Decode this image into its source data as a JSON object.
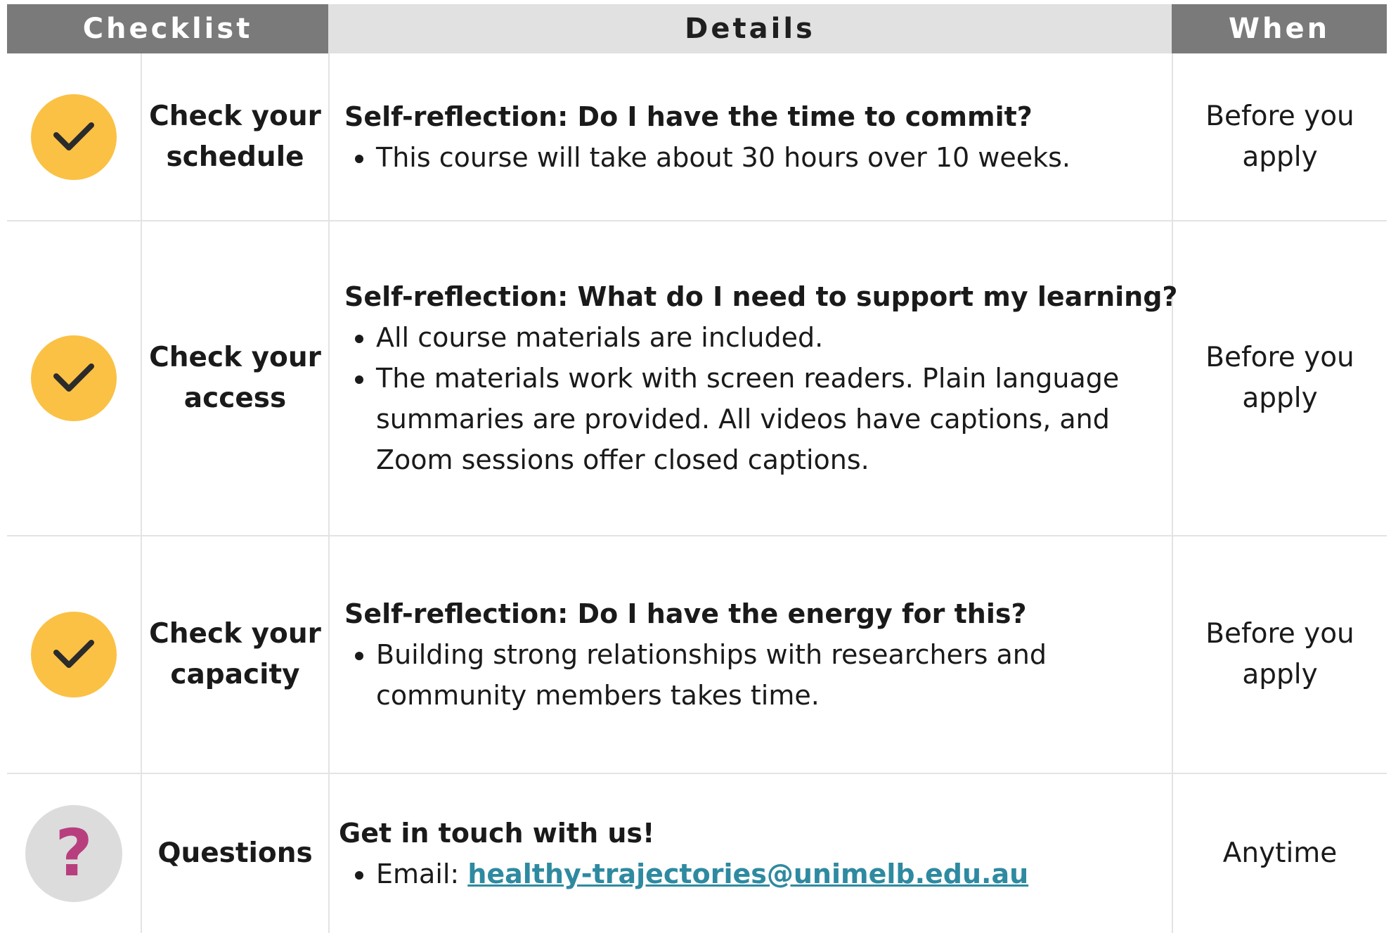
{
  "header": {
    "checklist": "Checklist",
    "details": "Details",
    "when": "When"
  },
  "rows": [
    {
      "icon": "check-icon",
      "label_line1": "Check your",
      "label_line2": "schedule",
      "title": "Self-reflection: Do I have the time to commit?",
      "bullets": [
        "This course will take about 30 hours over 10 weeks."
      ],
      "when_line1": "Before you",
      "when_line2": "apply"
    },
    {
      "icon": "check-icon",
      "label_line1": "Check your",
      "label_line2": "access",
      "title": "Self-reflection: What do I need to support my learning?",
      "bullets": [
        "All course materials are included.",
        "The materials work with screen readers. Plain language summaries are provided. All videos have captions, and Zoom sessions offer closed captions."
      ],
      "when_line1": "Before you",
      "when_line2": "apply"
    },
    {
      "icon": "check-icon",
      "label_line1": "Check your",
      "label_line2": "capacity",
      "title": "Self-reflection: Do I have the energy for this?",
      "bullets": [
        "Building strong relationships with researchers and community members takes time."
      ],
      "when_line1": "Before you",
      "when_line2": "apply"
    },
    {
      "icon": "question-icon",
      "symbol": "?",
      "label_line1": "Questions",
      "title": "Get in touch with us!",
      "email_prefix": "Email: ",
      "email": "healthy-trajectories@unimelb.edu.au",
      "when_line1": "Anytime"
    }
  ],
  "colors": {
    "header_dark": "#7a7a7a",
    "header_light": "#e1e1e1",
    "check_circle": "#fbc145",
    "question_circle": "#dcdcdc",
    "question_mark": "#b83f7e",
    "link": "#2e8aa0"
  }
}
